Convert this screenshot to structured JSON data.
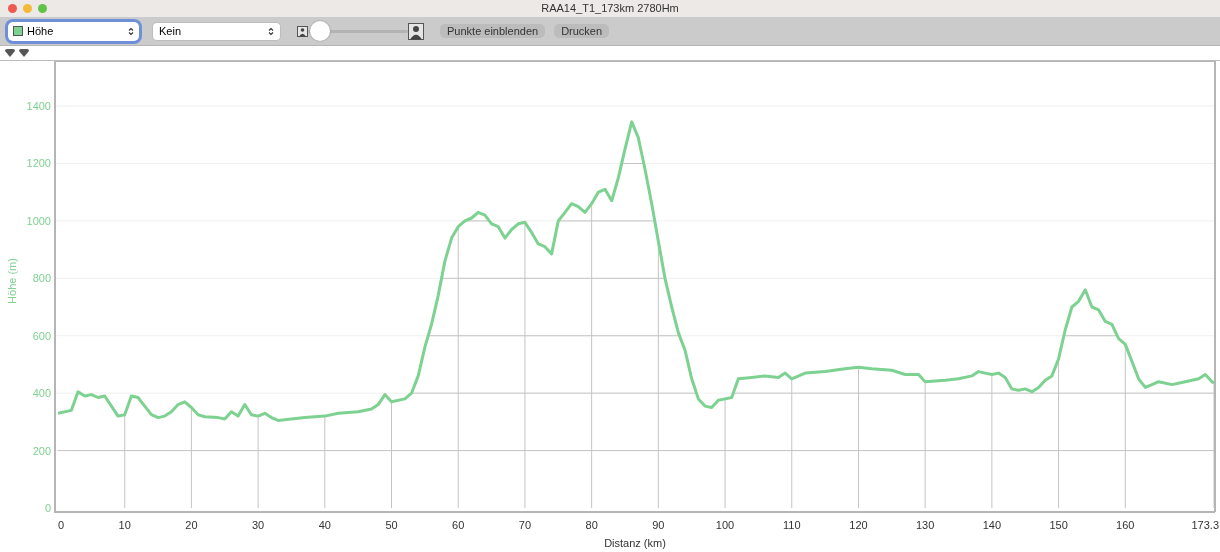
{
  "window": {
    "title": "RAA14_T1_173km 2780Hm"
  },
  "toolbar": {
    "primary_select": {
      "value": "Höhe",
      "color": "#7dd191",
      "focused": true
    },
    "secondary_select": {
      "value": "Kein",
      "focused": false
    },
    "size_slider": {
      "level": 0.02
    },
    "buttons": [
      "Punkte einblenden",
      "Drucken"
    ]
  },
  "chart": {
    "chart_data": {
      "type": "line",
      "xlabel": "Distanz (km)",
      "ylabel": "Höhe (m)",
      "xlim": [
        0,
        173.3
      ],
      "ylim": [
        0,
        1557
      ],
      "grid": true,
      "xticks": [
        0,
        10,
        20,
        30,
        40,
        50,
        60,
        70,
        80,
        90,
        100,
        110,
        120,
        130,
        140,
        150,
        160,
        173.3
      ],
      "yticks": [
        0,
        200,
        400,
        600,
        800,
        1000,
        1200,
        1400
      ],
      "x": [
        0,
        2,
        3,
        4,
        5,
        6,
        7,
        8,
        9,
        10,
        11,
        12,
        13,
        14,
        15,
        16,
        17,
        18,
        19,
        20,
        21,
        22,
        24,
        25,
        26,
        27,
        28,
        29,
        30,
        31,
        32,
        33,
        35,
        37,
        40,
        42,
        45,
        47,
        48,
        49,
        50,
        52,
        53,
        54,
        55,
        56,
        57,
        58,
        59,
        60,
        61,
        62,
        63,
        64,
        65,
        66,
        67,
        68,
        69,
        70,
        71,
        72,
        73,
        74,
        75,
        76,
        77,
        78,
        79,
        80,
        81,
        82,
        83,
        84,
        85,
        86,
        87,
        88,
        89,
        90,
        91,
        92,
        93,
        94,
        95,
        96,
        97,
        98,
        99,
        100,
        101,
        102,
        104,
        106,
        108,
        109,
        110,
        112,
        115,
        118,
        120,
        122,
        125,
        127,
        129,
        130,
        133,
        135,
        137,
        138,
        139,
        140,
        141,
        142,
        143,
        144,
        145,
        146,
        147,
        148,
        149,
        150,
        151,
        152,
        153,
        154,
        155,
        156,
        157,
        158,
        159,
        160,
        161,
        162,
        163,
        164,
        165,
        167,
        169,
        171,
        172,
        173,
        173.3
      ],
      "series": [
        {
          "color": "#7dd191",
          "values": [
            330,
            340,
            405,
            390,
            395,
            385,
            390,
            355,
            320,
            325,
            390,
            385,
            355,
            325,
            315,
            320,
            335,
            360,
            370,
            350,
            325,
            318,
            315,
            310,
            335,
            320,
            360,
            325,
            320,
            330,
            315,
            305,
            310,
            315,
            320,
            330,
            335,
            345,
            360,
            395,
            370,
            380,
            400,
            460,
            560,
            640,
            740,
            860,
            940,
            980,
            1000,
            1010,
            1030,
            1020,
            990,
            980,
            940,
            970,
            990,
            995,
            960,
            920,
            910,
            885,
            1000,
            1030,
            1060,
            1050,
            1030,
            1060,
            1100,
            1110,
            1070,
            1150,
            1250,
            1345,
            1290,
            1180,
            1060,
            930,
            800,
            700,
            610,
            550,
            450,
            380,
            355,
            350,
            375,
            380,
            385,
            450,
            455,
            460,
            455,
            470,
            450,
            470,
            475,
            485,
            490,
            485,
            480,
            465,
            465,
            440,
            445,
            450,
            460,
            475,
            470,
            465,
            470,
            455,
            415,
            410,
            415,
            405,
            420,
            445,
            460,
            520,
            620,
            700,
            720,
            760,
            700,
            690,
            650,
            640,
            590,
            570,
            510,
            450,
            420,
            430,
            440,
            430,
            440,
            450,
            465,
            440,
            435
          ]
        }
      ]
    }
  }
}
